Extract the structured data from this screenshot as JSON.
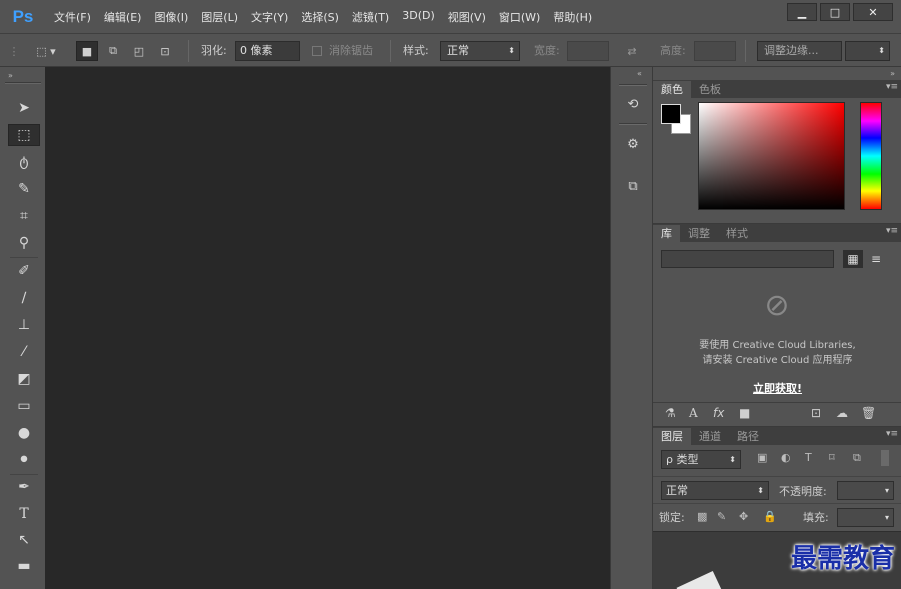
{
  "app": {
    "logo": "Ps"
  },
  "menu": [
    "文件(F)",
    "编辑(E)",
    "图像(I)",
    "图层(L)",
    "文字(Y)",
    "选择(S)",
    "滤镜(T)",
    "3D(D)",
    "视图(V)",
    "窗口(W)",
    "帮助(H)"
  ],
  "window_controls": {
    "minimize": "▁",
    "restore": "□",
    "close": "✕"
  },
  "options": {
    "feather_label": "羽化:",
    "feather_value": "0 像素",
    "antialias_label": "消除锯齿",
    "style_label": "样式:",
    "style_value": "正常",
    "width_label": "宽度:",
    "height_label": "高度:",
    "refine_label": "调整边缘..."
  },
  "color_panel": {
    "tabs": [
      "颜色",
      "色板"
    ],
    "fg_color": "#000000",
    "bg_color": "#ffffff"
  },
  "library_panel": {
    "tabs": [
      "库",
      "调整",
      "样式"
    ],
    "message_line1": "要使用 Creative Cloud Libraries,",
    "message_line2": "请安装 Creative Cloud 应用程序",
    "link": "立即获取!"
  },
  "layers_panel": {
    "tabs": [
      "图层",
      "通道",
      "路径"
    ],
    "filter_label": "ρ 类型",
    "blend_mode": "正常",
    "opacity_label": "不透明度:",
    "lock_label": "锁定:",
    "fill_label": "填充:"
  },
  "watermark": "最需教育"
}
